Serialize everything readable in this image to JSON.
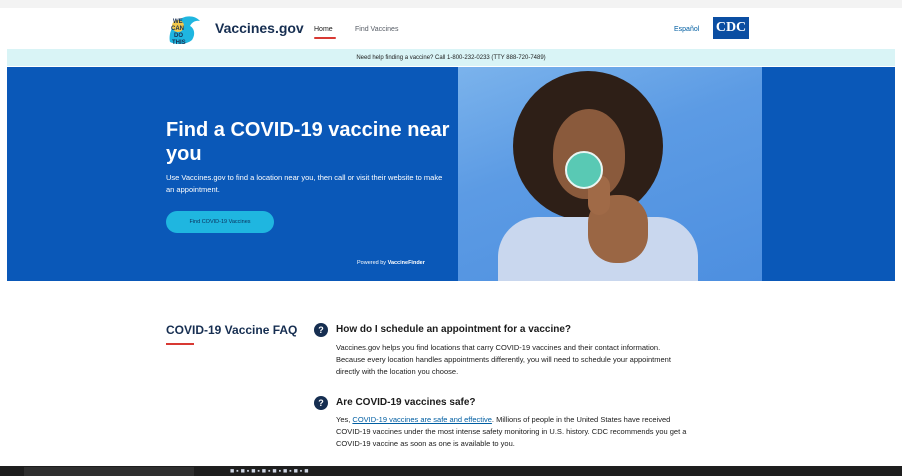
{
  "header": {
    "brand": "Vaccines.gov",
    "logo_text": "WE CAN DO THIS",
    "nav": [
      "Home",
      "Find Vaccines"
    ],
    "language": "Español",
    "cdc_logo": "CDC"
  },
  "banner": {
    "text": "Need help finding a vaccine? Call 1-800-232-0233 (TTY 888-720-7489)"
  },
  "hero": {
    "title": "Find a COVID-19 vaccine near you",
    "subtitle": "Use Vaccines.gov to find a location near you, then call or visit their website to make an appointment.",
    "button": "Find COVID-19 Vaccines",
    "powered_by_prefix": "Powered by",
    "powered_by_name": "VaccineFinder"
  },
  "faq": {
    "title": "COVID-19 Vaccine FAQ",
    "items": [
      {
        "icon": "question-icon",
        "question": "How do I schedule an appointment for a vaccine?",
        "answer": "Vaccines.gov helps you find locations that carry COVID-19 vaccines and their contact information. Because every location handles appointments differently, you will need to schedule your appointment directly with the location you choose."
      },
      {
        "icon": "question-icon",
        "question": "Are COVID-19 vaccines safe?",
        "answer_prefix": "Yes, ",
        "answer_link": "COVID-19 vaccines are safe and effective",
        "answer_suffix": ". Millions of people in the United States have received COVID-19 vaccines under the most intense safety monitoring in U.S. history. CDC recommends you get a COVID-19 vaccine as soon as one is available to you."
      }
    ]
  },
  "colors": {
    "hero_blue": "#0a58b8",
    "banner_bg": "#d9f4f6",
    "button": "#1fb6e0",
    "accent_red": "#d83933",
    "navy": "#162e51"
  }
}
